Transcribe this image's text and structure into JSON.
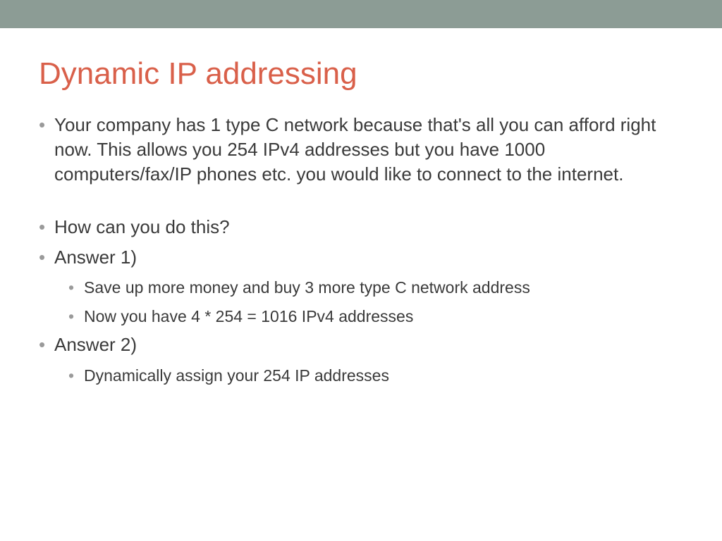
{
  "slide": {
    "title": "Dynamic IP addressing",
    "bullets": [
      {
        "text": "Your company has 1 type C network because that's all you can afford right now. This allows you 254 IPv4 addresses but you have 1000 computers/fax/IP phones etc.  you would like to connect to the internet.",
        "spacer": true
      },
      {
        "text": "How can you do this?"
      },
      {
        "text": "Answer 1)",
        "sub": [
          "Save up more money and buy 3 more type C network address",
          "Now you have 4 * 254 = 1016 IPv4 addresses"
        ]
      },
      {
        "text": "Answer 2)",
        "sub": [
          "Dynamically assign your 254 IP addresses"
        ]
      }
    ]
  }
}
